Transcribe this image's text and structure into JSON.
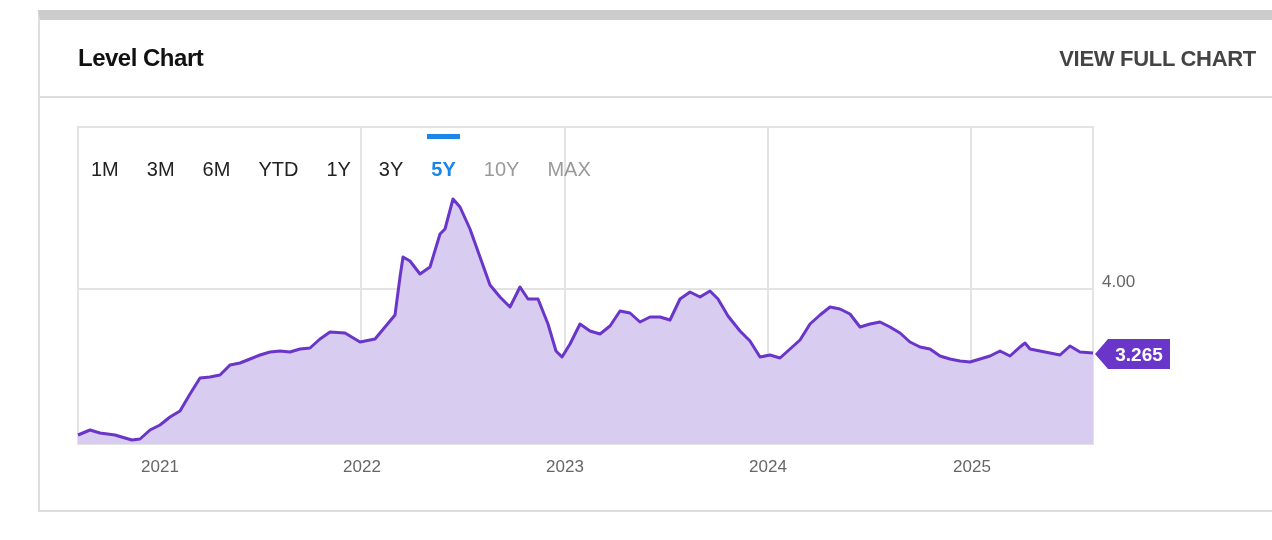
{
  "card": {
    "title": "Level Chart",
    "link": "VIEW FULL CHART"
  },
  "ranges": [
    {
      "label": "1M",
      "selected": false,
      "disabled": false
    },
    {
      "label": "3M",
      "selected": false,
      "disabled": false
    },
    {
      "label": "6M",
      "selected": false,
      "disabled": false
    },
    {
      "label": "YTD",
      "selected": false,
      "disabled": false
    },
    {
      "label": "1Y",
      "selected": false,
      "disabled": false
    },
    {
      "label": "3Y",
      "selected": false,
      "disabled": false
    },
    {
      "label": "5Y",
      "selected": true,
      "disabled": false
    },
    {
      "label": "10Y",
      "selected": false,
      "disabled": true
    },
    {
      "label": "MAX",
      "selected": false,
      "disabled": true
    }
  ],
  "chart": {
    "y_tick": "4.00",
    "x_labels": [
      "2021",
      "2022",
      "2023",
      "2024",
      "2025"
    ],
    "current_value": "3.265"
  }
}
